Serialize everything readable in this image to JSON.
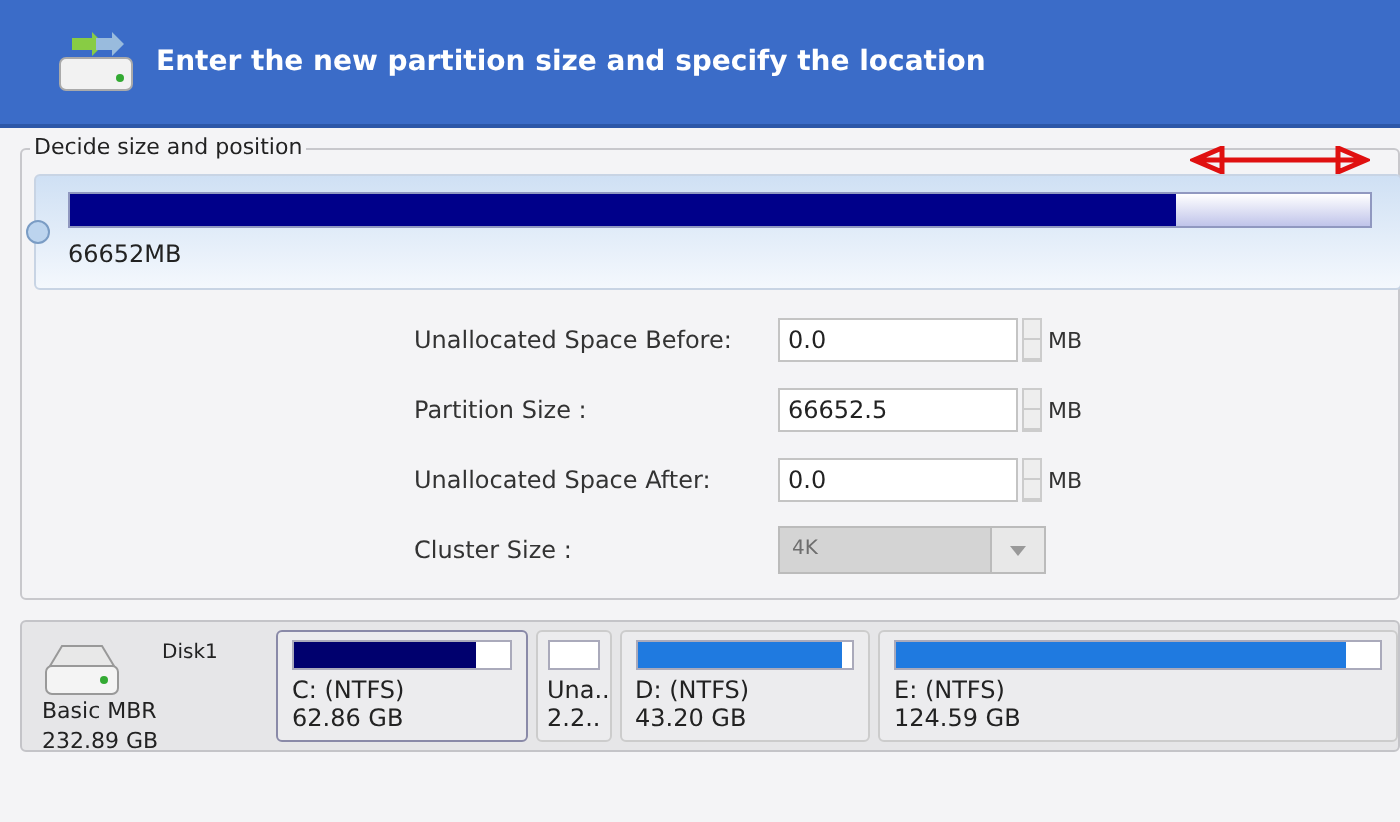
{
  "header": {
    "title": "Enter the new partition size and specify the location"
  },
  "group": {
    "title": "Decide size and position",
    "slider": {
      "level": 0.85,
      "reading": "66652MB"
    },
    "fields": [
      {
        "kind": "spin",
        "label": "Unallocated Space Before:",
        "value": "0.0",
        "unit": "MB",
        "disabled": false
      },
      {
        "kind": "spin",
        "label": "Partition Size :",
        "value": "66652.5",
        "unit": "MB",
        "disabled": false
      },
      {
        "kind": "spin",
        "label": "Unallocated Space After:",
        "value": "0.0",
        "unit": "MB",
        "disabled": false
      },
      {
        "kind": "dropdown",
        "label": "Cluster Size :",
        "value": "4K",
        "disabled": true
      }
    ]
  },
  "disk": {
    "name": "Disk1",
    "type": "Basic MBR",
    "size": "232.89 GB",
    "partitions": [
      {
        "name": "C: (NTFS)",
        "size": "62.86 GB",
        "level": 0.85,
        "selected": true
      },
      {
        "name": "Una..",
        "size": "2.2..",
        "level": 0,
        "selected": false
      },
      {
        "name": "D: (NTFS)",
        "size": "43.20 GB",
        "level": 0.95,
        "selected": false
      },
      {
        "name": "E: (NTFS)",
        "size": "124.59 GB",
        "level": 0.93,
        "selected": false
      }
    ]
  }
}
